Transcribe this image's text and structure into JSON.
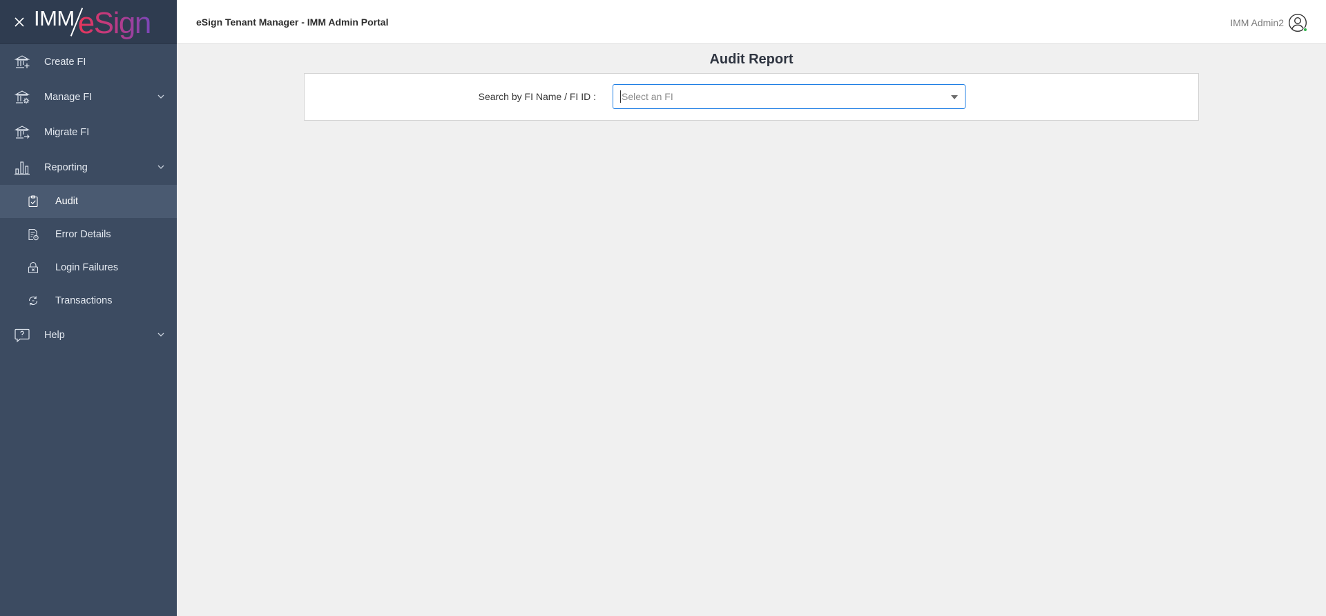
{
  "header": {
    "app_title": "eSign Tenant Manager - IMM Admin Portal",
    "user_name": "IMM Admin2"
  },
  "logo": {
    "part1": "IMM",
    "part2": "eSign"
  },
  "sidebar": {
    "items": [
      {
        "label": "Create FI",
        "icon": "bank-add-icon"
      },
      {
        "label": "Manage FI",
        "icon": "bank-settings-icon",
        "expandable": true
      },
      {
        "label": "Migrate FI",
        "icon": "bank-migrate-icon"
      },
      {
        "label": "Reporting",
        "icon": "bar-chart-icon",
        "expandable": true,
        "expanded": true
      }
    ],
    "reporting_subitems": [
      {
        "label": "Audit",
        "icon": "clipboard-check-icon",
        "active": true
      },
      {
        "label": "Error Details",
        "icon": "document-error-icon"
      },
      {
        "label": "Login Failures",
        "icon": "lock-x-icon"
      },
      {
        "label": "Transactions",
        "icon": "refresh-cycle-icon"
      }
    ],
    "help": {
      "label": "Help",
      "icon": "question-bubble-icon",
      "expandable": true
    }
  },
  "main": {
    "page_title": "Audit Report",
    "search": {
      "label": "Search by FI Name / FI ID :",
      "placeholder": "Select an FI",
      "value": ""
    }
  },
  "colors": {
    "sidebar_bg": "#3c4b61",
    "sidebar_header_bg": "#2f3c50",
    "active_item_bg": "#4a5a71",
    "focus_border": "#1e7ee4",
    "status_online": "#2fb44a"
  }
}
